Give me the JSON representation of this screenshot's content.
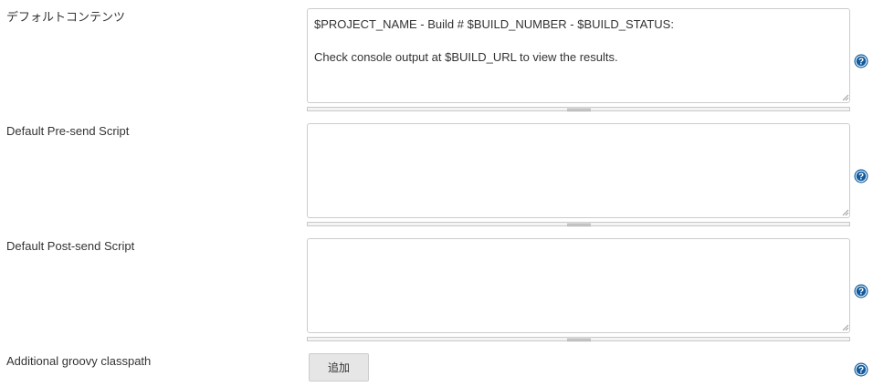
{
  "fields": [
    {
      "label": "デフォルトコンテンツ",
      "value": "$PROJECT_NAME - Build # $BUILD_NUMBER - $BUILD_STATUS:\n\nCheck console output at $BUILD_URL to view the results.",
      "help_icon": "question-circle-icon"
    },
    {
      "label": "Default Pre-send Script",
      "value": "",
      "help_icon": "question-circle-icon"
    },
    {
      "label": "Default Post-send Script",
      "value": "",
      "help_icon": "question-circle-icon"
    }
  ],
  "classpath": {
    "label": "Additional groovy classpath",
    "add_button_label": "追加",
    "help_icon": "question-circle-icon"
  },
  "colors": {
    "help_icon": "#0f5b9e",
    "button_bg": "#e6e6e6",
    "border": "#cccccc",
    "text": "#333333"
  }
}
